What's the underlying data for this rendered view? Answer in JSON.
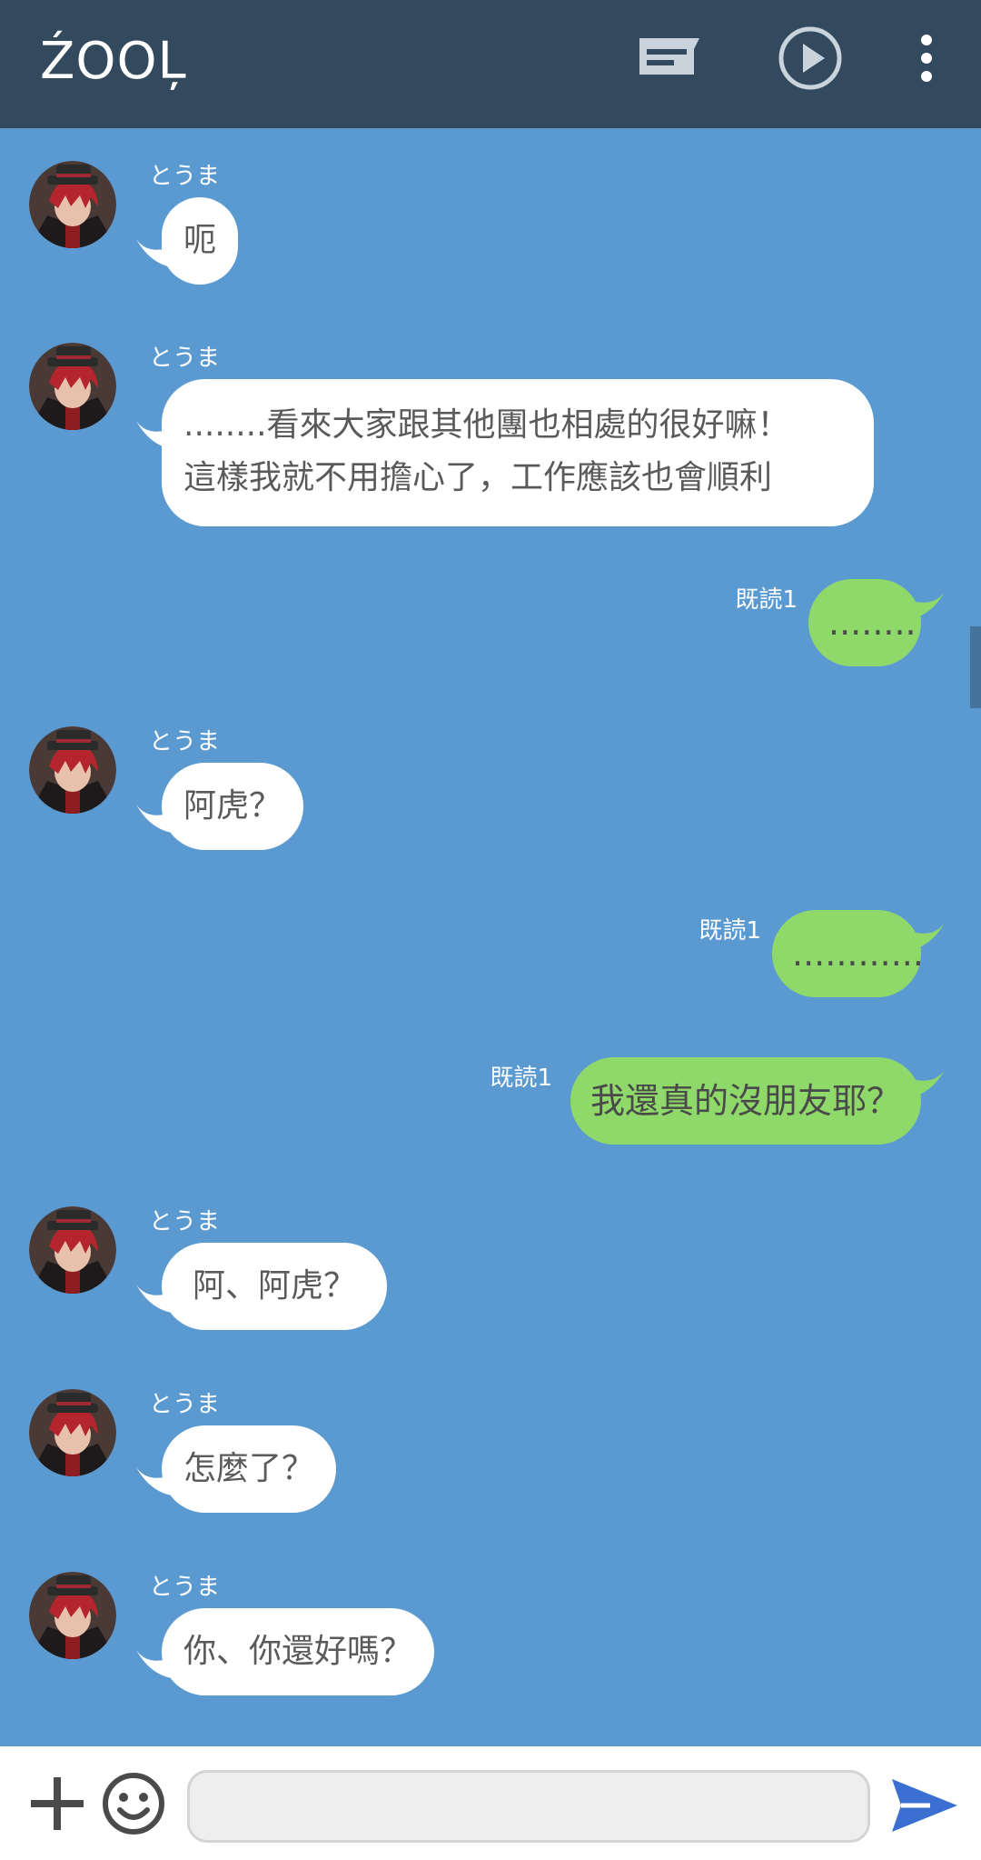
{
  "header": {
    "title": "ŹOOĻ",
    "icons": [
      "notes-icon",
      "play-icon",
      "more-icon"
    ],
    "background": "#334a5e"
  },
  "chat": {
    "background": "#5b9ad1",
    "incoming_bubble_color": "#ffffff",
    "outgoing_bubble_color": "#8fd96a",
    "messages": [
      {
        "direction": "in",
        "sender": "とうま",
        "lines": [
          "呃"
        ]
      },
      {
        "direction": "in",
        "sender": "とうま",
        "lines": [
          "........看來大家跟其他團也相處的很好嘛！",
          "這樣我就不用擔心了，工作應該也會順利"
        ]
      },
      {
        "direction": "out",
        "read": "既読1",
        "text": "........"
      },
      {
        "direction": "in",
        "sender": "とうま",
        "lines": [
          "阿虎？"
        ]
      },
      {
        "direction": "out",
        "read": "既読1",
        "text": "............"
      },
      {
        "direction": "out",
        "read": "既読1",
        "text": "我還真的沒朋友耶？"
      },
      {
        "direction": "in",
        "sender": "とうま",
        "lines": [
          "阿、阿虎？"
        ]
      },
      {
        "direction": "in",
        "sender": "とうま",
        "lines": [
          "怎麼了？"
        ]
      },
      {
        "direction": "in",
        "sender": "とうま",
        "lines": [
          "你、你還好嗎？"
        ]
      }
    ]
  },
  "input_bar": {
    "placeholder": "",
    "value": "",
    "icons": [
      "plus-icon",
      "emoji-icon",
      "send-icon"
    ],
    "send_color": "#3b6fd0"
  }
}
